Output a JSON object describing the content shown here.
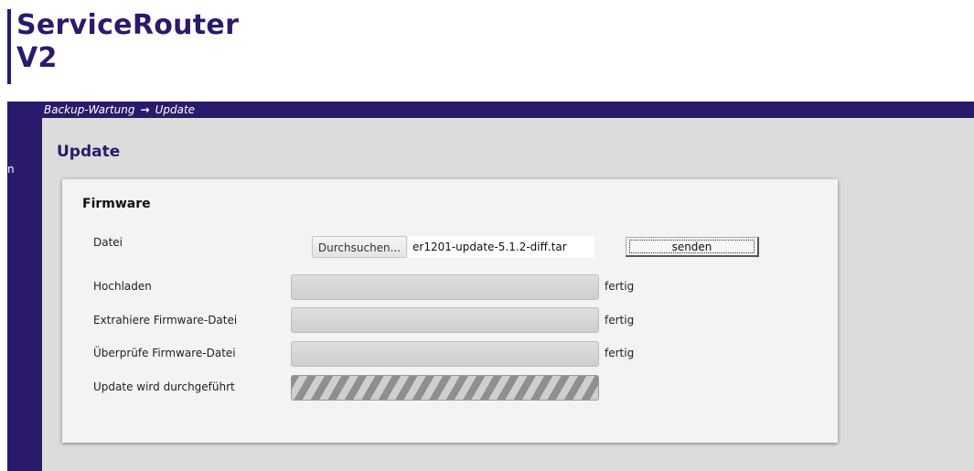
{
  "brand": {
    "title_line1": "ServiceRouter",
    "title_line2": "V2"
  },
  "breadcrumb": {
    "parent": "Backup-Wartung",
    "separator": "→",
    "current": "Update"
  },
  "sidebar": {
    "visible_fragment": "n"
  },
  "page": {
    "title": "Update"
  },
  "firmware": {
    "section_title": "Firmware",
    "file_label": "Datei",
    "browse_label": "Durchsuchen...",
    "file_name": "er1201-update-5.1.2-diff.tar",
    "send_label": "senden",
    "steps": [
      {
        "label": "Hochladen",
        "status": "fertig",
        "progress": 1.0,
        "state": "done"
      },
      {
        "label": "Extrahiere Firmware-Datei",
        "status": "fertig",
        "progress": 1.0,
        "state": "done"
      },
      {
        "label": "Überprüfe Firmware-Datei",
        "status": "fertig",
        "progress": 1.0,
        "state": "done"
      },
      {
        "label": "Update wird durchgeführt",
        "status": "",
        "progress": 1.0,
        "state": "in-progress"
      }
    ]
  },
  "colors": {
    "brand": "#2b1a6b",
    "content_background": "#dcdcdc",
    "card_background": "#f3f3f3"
  }
}
